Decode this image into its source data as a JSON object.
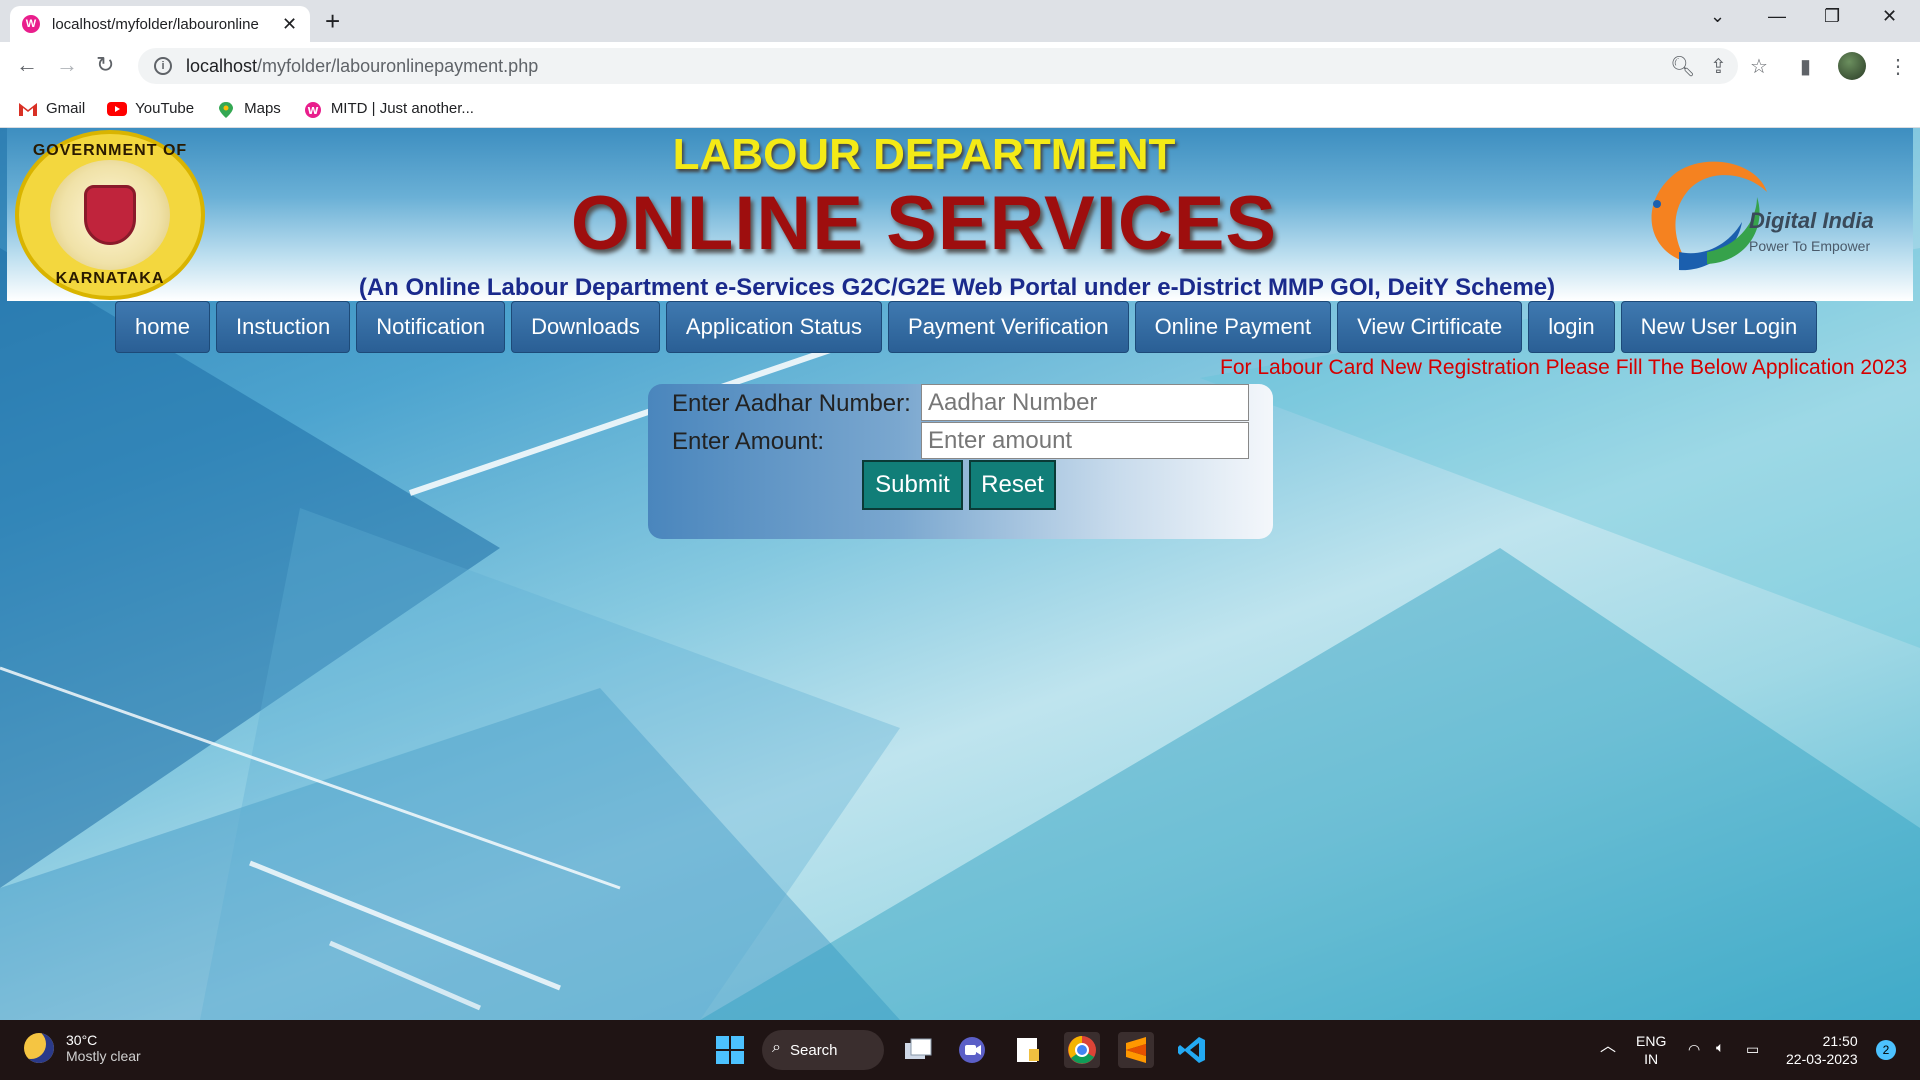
{
  "browser": {
    "tab_title": "localhost/myfolder/labouronline",
    "tab_favicon": "W",
    "url_host": "localhost",
    "url_path": "/myfolder/labouronlinepayment.php",
    "bookmarks": [
      {
        "label": "Gmail",
        "icon": "gmail-icon",
        "color": "#d93025"
      },
      {
        "label": "YouTube",
        "icon": "youtube-icon",
        "color": "#ff0000"
      },
      {
        "label": "Maps",
        "icon": "maps-icon",
        "color": "#34a853"
      },
      {
        "label": "MITD | Just another...",
        "icon": "mitd-icon",
        "color": "#e91e8c"
      }
    ]
  },
  "banner": {
    "title_top": "LABOUR DEPARTMENT",
    "title_main": "ONLINE SERVICES",
    "subtitle": "(An Online Labour Department e-Services G2C/G2E Web Portal under e-District MMP GOI, DeitY Scheme)",
    "seal_top": "GOVERNMENT OF",
    "seal_bottom": "KARNATAKA",
    "di_name": "Digital India",
    "di_tagline": "Power To Empower"
  },
  "menu": [
    "home",
    "Instuction",
    "Notification",
    "Downloads",
    "Application Status",
    "Payment Verification",
    "Online Payment",
    "View Cirtificate",
    "login",
    "New User Login"
  ],
  "marquee": "For Labour Card New Registration Please Fill The Below Application 2023",
  "form": {
    "aadhar_label": "Enter Aadhar Number:",
    "aadhar_placeholder": "Aadhar Number",
    "amount_label": "Enter Amount:",
    "amount_placeholder": "Enter amount",
    "submit": "Submit",
    "reset": "Reset"
  },
  "taskbar": {
    "temp": "30°C",
    "weather": "Mostly clear",
    "search": "Search",
    "lang1": "ENG",
    "lang2": "IN",
    "time": "21:50",
    "date": "22-03-2023",
    "notifications": "2"
  },
  "colors": {
    "menu_bg": "#2f6aa3",
    "title_red": "#9e0e0e",
    "title_yellow": "#f4ea16",
    "marquee_red": "#d40000",
    "button_teal": "#117e78"
  }
}
